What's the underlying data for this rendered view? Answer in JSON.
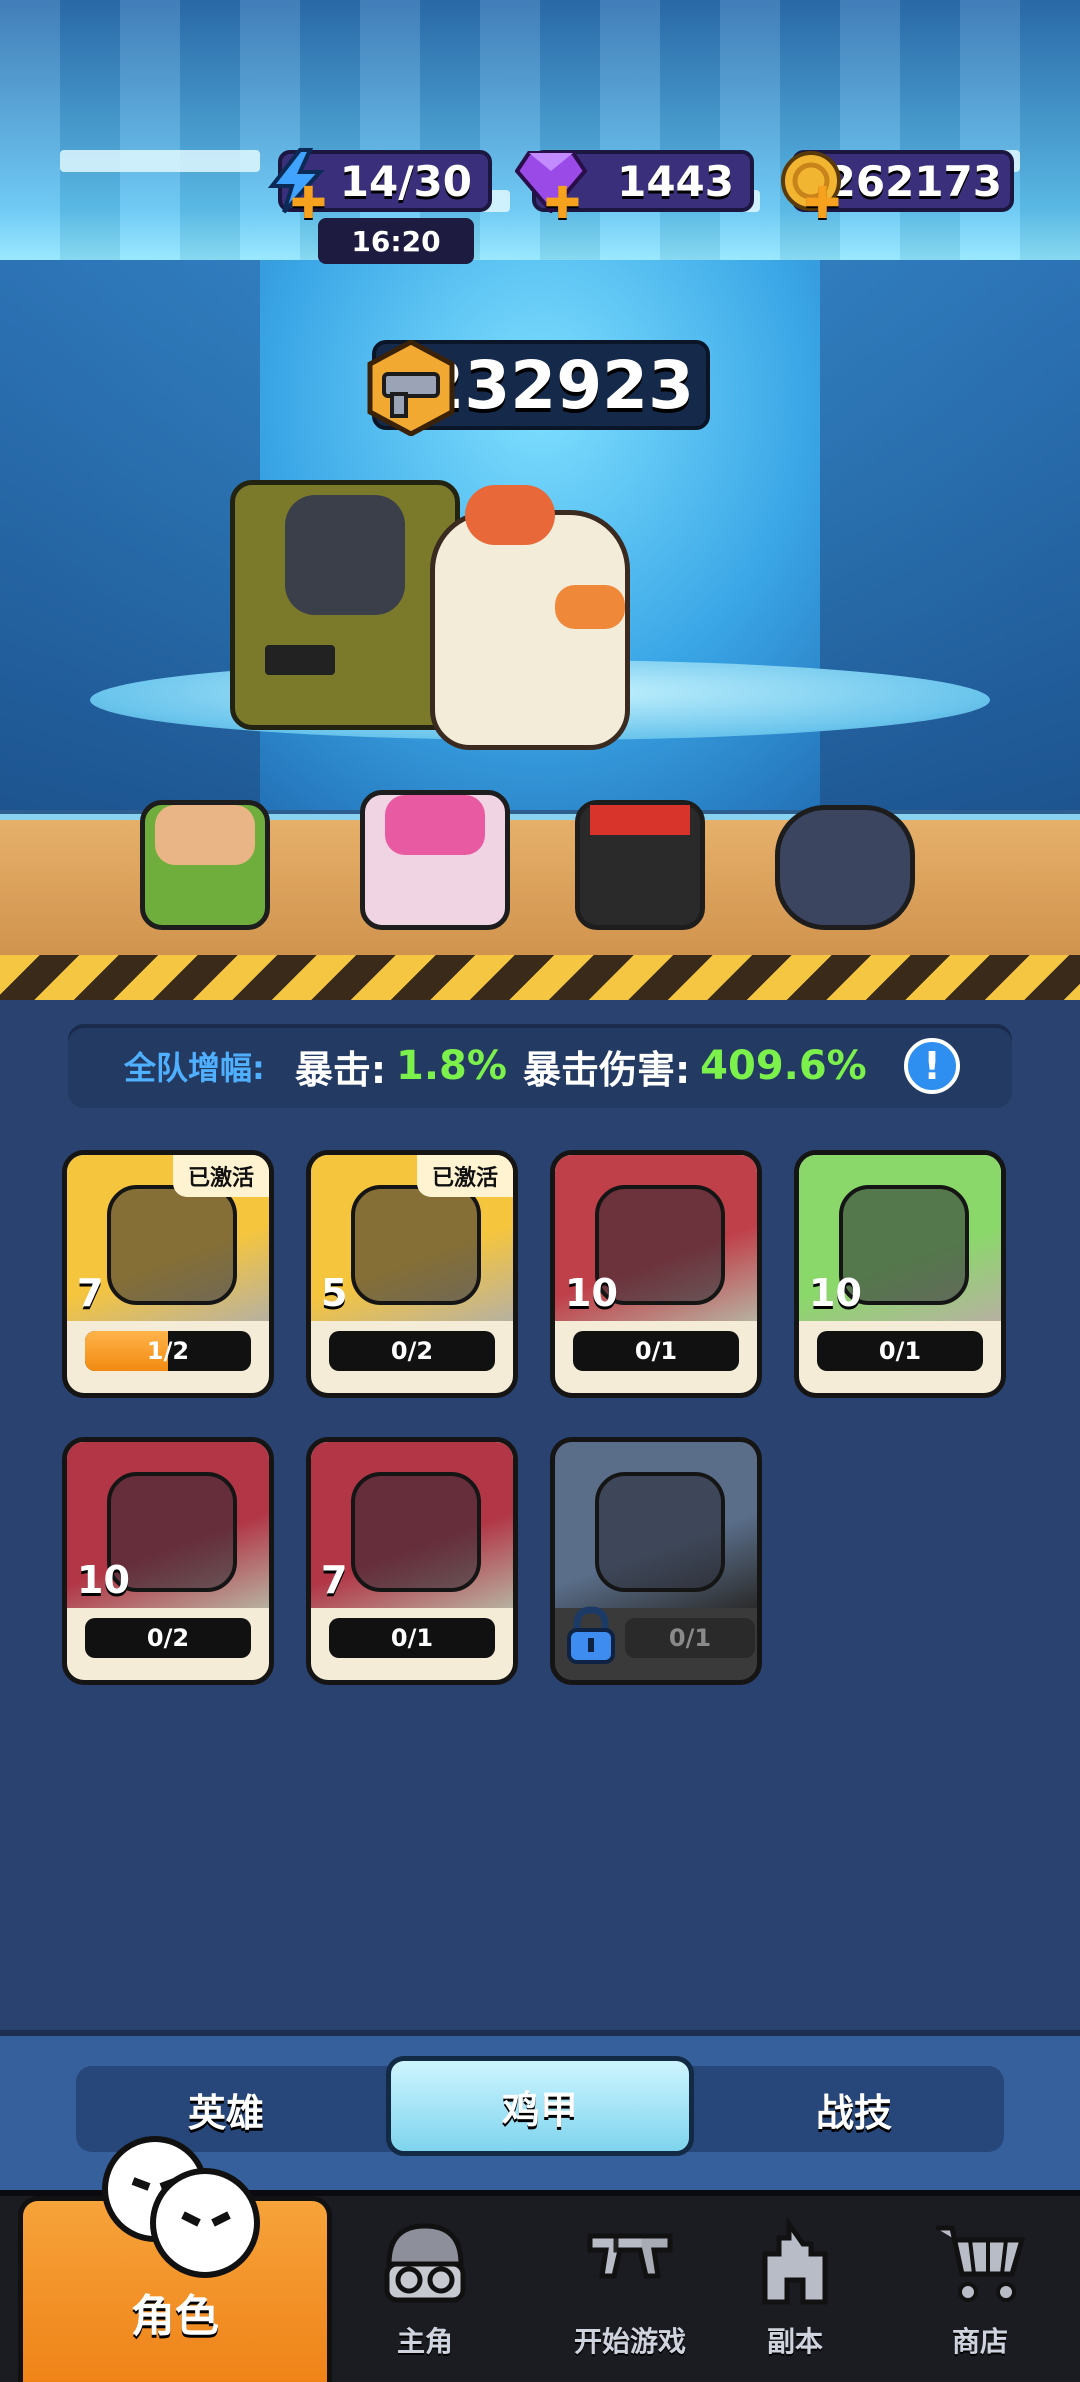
{
  "resources": {
    "energy": {
      "value": "14/30",
      "timer": "16:20",
      "icon": "lightning-icon"
    },
    "gems": {
      "value": "1443",
      "icon": "purple-gem-icon"
    },
    "coins": {
      "value": "262173",
      "icon": "gold-coin-icon"
    }
  },
  "power": {
    "value": "2232923",
    "icon": "gun-power-icon"
  },
  "team_buff": {
    "label": "全队增幅:",
    "crit_label": "暴击:",
    "crit_value": "1.8%",
    "critdmg_label": "暴击伤害:",
    "critdmg_value": "409.6%",
    "info_icon": "!"
  },
  "cards": [
    {
      "level": "7",
      "tag": "已激活",
      "progress": "1/2",
      "fill": 0.5,
      "bg": "#f5c53e",
      "art": "chicken-mech"
    },
    {
      "level": "5",
      "tag": "已激活",
      "progress": "0/2",
      "fill": 0,
      "bg": "#f5c53e",
      "art": "gorilla-mech"
    },
    {
      "level": "10",
      "tag": "",
      "progress": "0/1",
      "fill": 0,
      "bg": "#c0404a",
      "art": "red-rooster-mech"
    },
    {
      "level": "10",
      "tag": "",
      "progress": "0/1",
      "fill": 0,
      "bg": "#8ad86a",
      "art": "pink-mech"
    },
    {
      "level": "10",
      "tag": "",
      "progress": "0/2",
      "fill": 0,
      "bg": "#b23646",
      "art": "purple-mech"
    },
    {
      "level": "7",
      "tag": "",
      "progress": "0/1",
      "fill": 0,
      "bg": "#b23646",
      "art": "red-hat-mech"
    },
    {
      "level": "",
      "tag": "",
      "progress": "0/1",
      "fill": 0,
      "bg": "#5a6e8a",
      "art": "locked-mech",
      "locked": true
    }
  ],
  "sub_tabs": {
    "hero": "英雄",
    "mech": "鸡甲",
    "skill": "战技"
  },
  "nav": {
    "role": "角色",
    "main": "主角",
    "start": "开始游戏",
    "dungeon": "副本",
    "shop": "商店"
  }
}
